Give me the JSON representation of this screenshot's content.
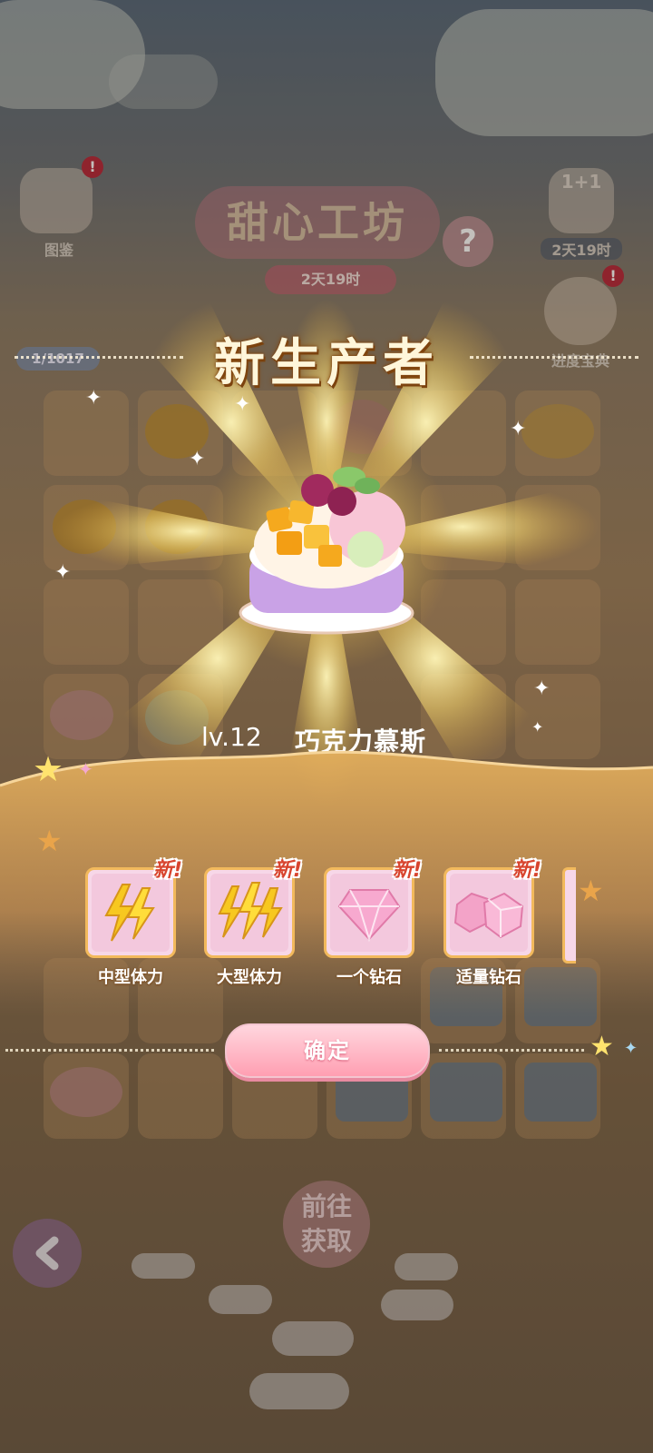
{
  "hud": {
    "left_icon_label": "图鉴",
    "left_badge": "!",
    "right_badge_top": "1+1",
    "right_timer": "2天19时",
    "right_icon_label": "进度宝典",
    "right_badge": "!",
    "event_title": "甜心工坊",
    "help_symbol": "?",
    "event_timer": "2天19时",
    "score": "1/1017"
  },
  "popup": {
    "title": "新生产者",
    "item_level": "lv.12",
    "item_name": "巧克力慕斯",
    "rewards": [
      {
        "label": "中型体力",
        "tag": "新!",
        "icon": "double-lightning-icon"
      },
      {
        "label": "大型体力",
        "tag": "新!",
        "icon": "triple-lightning-icon"
      },
      {
        "label": "一个钻石",
        "tag": "新!",
        "icon": "pink-diamond-icon"
      },
      {
        "label": "适量钻石",
        "tag": "新!",
        "icon": "pink-diamonds-pile-icon"
      }
    ],
    "confirm_label": "确定"
  },
  "bottom": {
    "goto_label_1": "前往",
    "goto_label_2": "获取"
  },
  "colors": {
    "accent_pink": "#ff9fb2",
    "gold": "#f2b95c",
    "new_tag": "#d8442e"
  }
}
